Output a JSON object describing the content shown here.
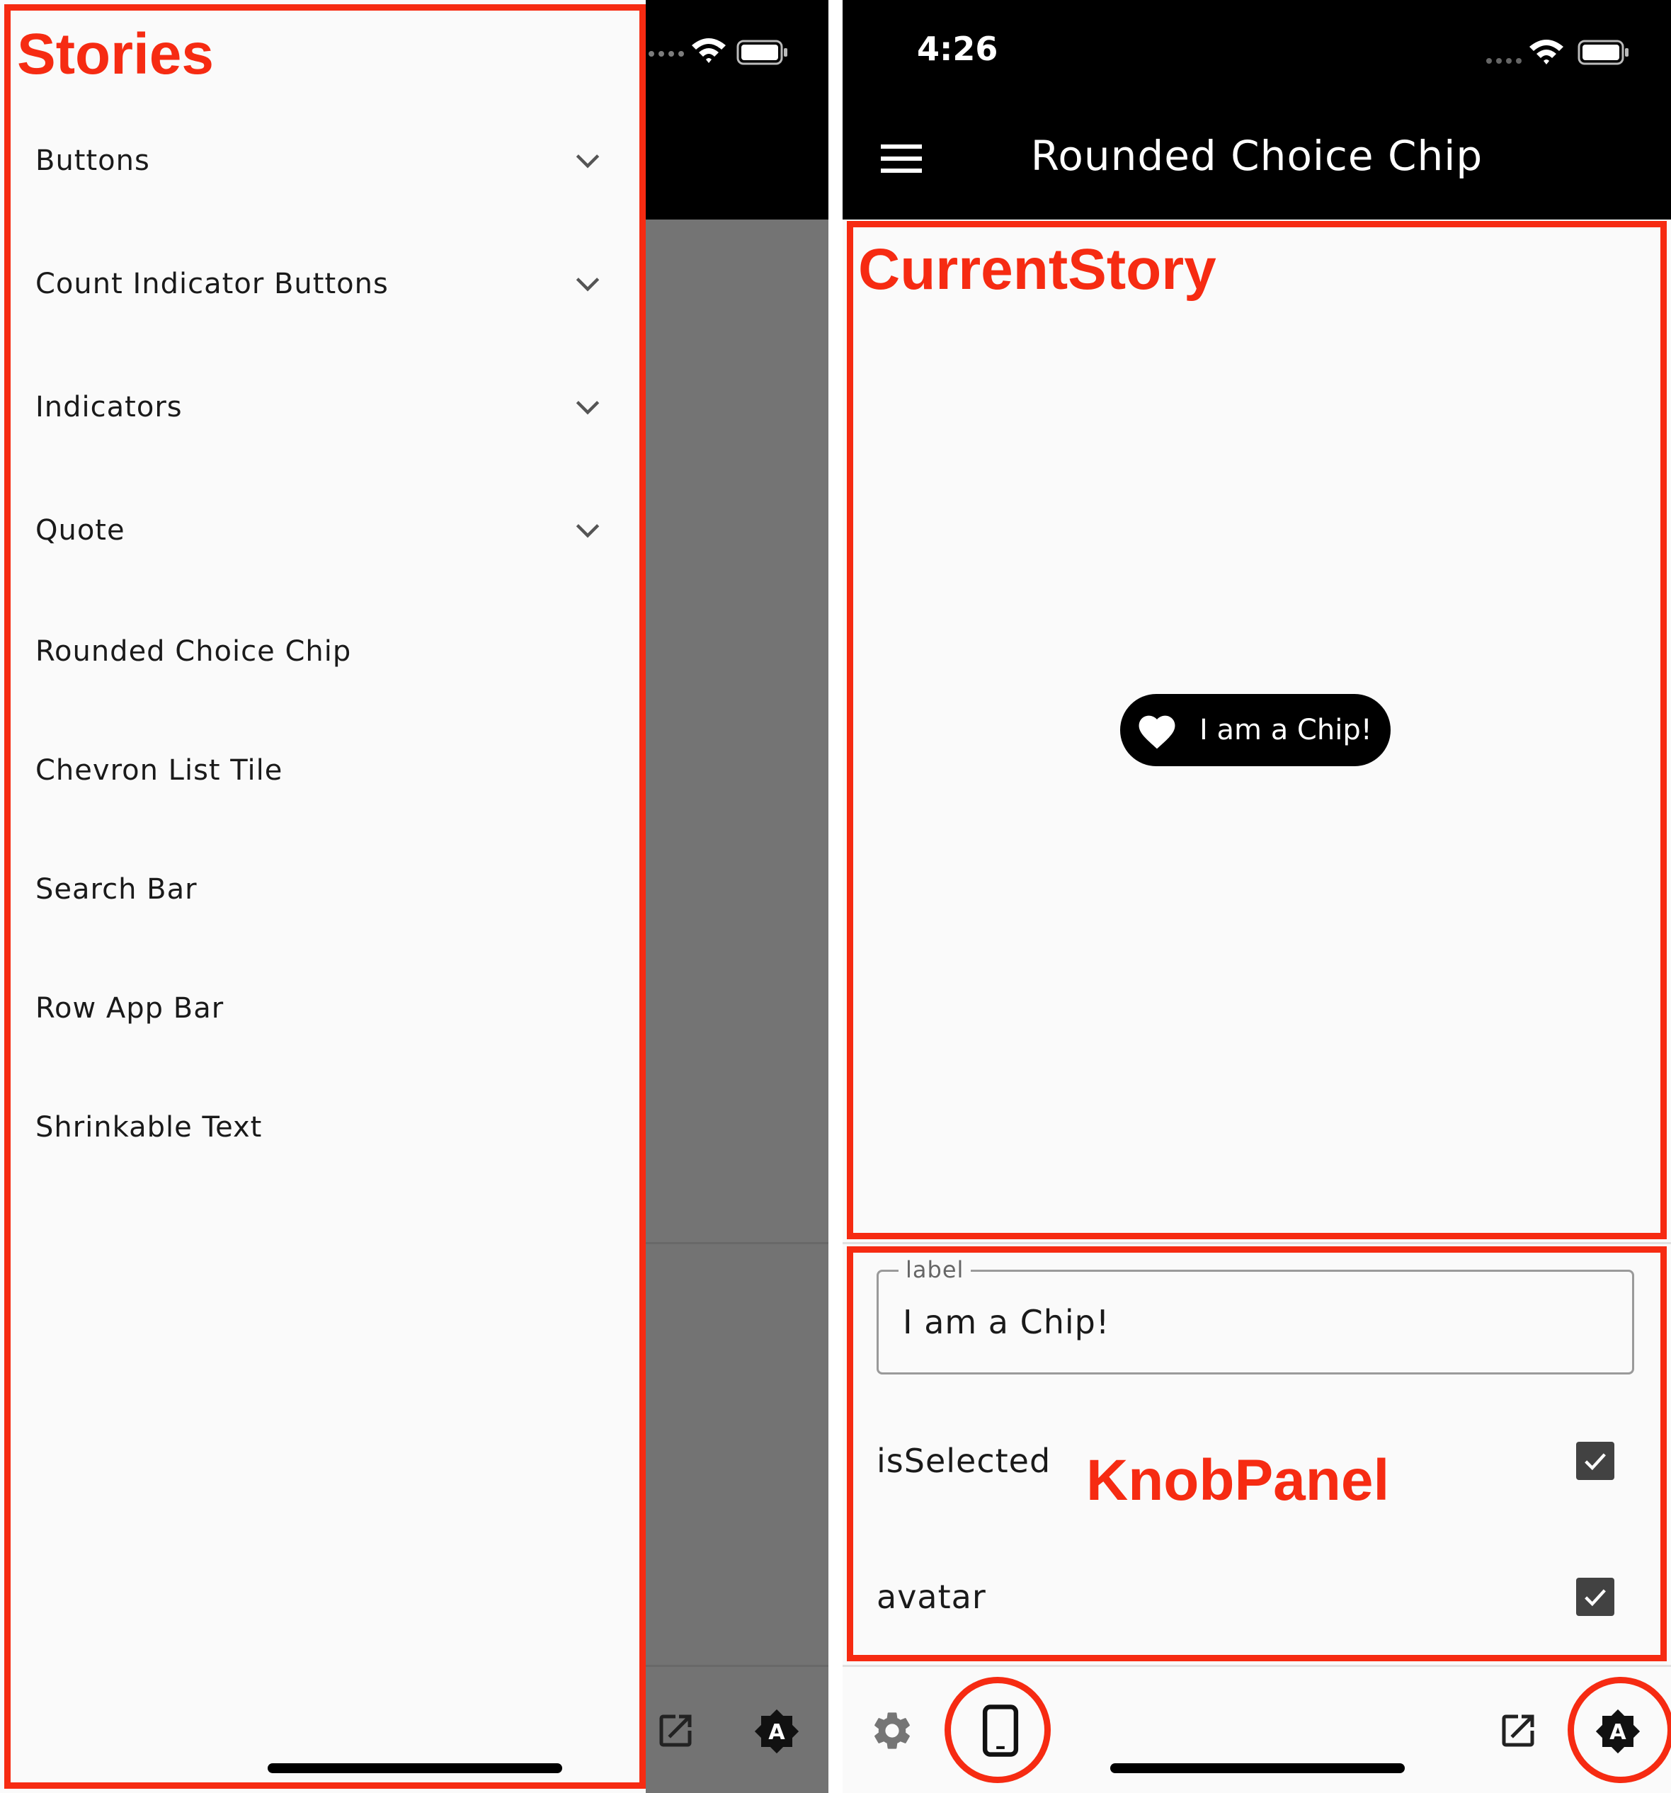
{
  "left_screen": {
    "drawer_title": "Stories",
    "stories": [
      {
        "label": "Buttons",
        "expandable": true
      },
      {
        "label": "Count Indicator Buttons",
        "expandable": true
      },
      {
        "label": "Indicators",
        "expandable": true
      },
      {
        "label": "Quote",
        "expandable": true
      },
      {
        "label": "Rounded Choice Chip",
        "expandable": false
      },
      {
        "label": "Chevron List Tile",
        "expandable": false
      },
      {
        "label": "Search Bar",
        "expandable": false
      },
      {
        "label": "Row App Bar",
        "expandable": false
      },
      {
        "label": "Shrinkable Text",
        "expandable": false
      }
    ],
    "bottom_icons": [
      "open-in-new-icon",
      "theme-auto-icon"
    ]
  },
  "right_screen": {
    "status_time": "4:26",
    "app_bar_title": "Rounded Choice Chip",
    "current_story_annotation": "CurrentStory",
    "chip": {
      "label": "I am a Chip!",
      "icon": "heart-icon"
    },
    "knob_panel_annotation": "KnobPanel",
    "knobs": {
      "label_field_label": "label",
      "label_field_value": "I am a Chip!",
      "is_selected_label": "isSelected",
      "is_selected_checked": true,
      "avatar_label": "avatar",
      "avatar_checked": true
    },
    "bottom_icons": [
      "gear-icon",
      "phone-icon",
      "open-in-new-icon",
      "theme-auto-icon"
    ]
  },
  "colors": {
    "annotation": "#f62b12",
    "app_bar": "#000000",
    "background": "#fafafa",
    "scrim": "#747474",
    "checkbox": "#424242"
  }
}
